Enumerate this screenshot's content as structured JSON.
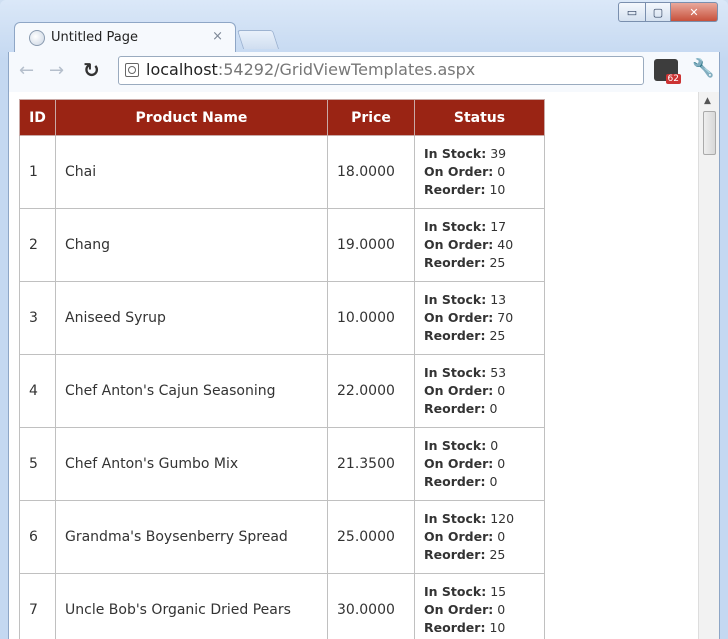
{
  "browser": {
    "tab_title": "Untitled Page",
    "tab_close": "×",
    "url_host": "localhost",
    "url_rest": ":54292/GridViewTemplates.aspx",
    "controls": {
      "minimize": "▭",
      "maximize": "▢",
      "close": "✕"
    }
  },
  "grid": {
    "headers": [
      "ID",
      "Product Name",
      "Price",
      "Status"
    ],
    "status_labels": {
      "in_stock": "In Stock:",
      "on_order": "On Order:",
      "reorder": "Reorder:"
    },
    "rows": [
      {
        "id": "1",
        "name": "Chai",
        "price": "18.0000",
        "in_stock": "39",
        "on_order": "0",
        "reorder": "10"
      },
      {
        "id": "2",
        "name": "Chang",
        "price": "19.0000",
        "in_stock": "17",
        "on_order": "40",
        "reorder": "25"
      },
      {
        "id": "3",
        "name": "Aniseed Syrup",
        "price": "10.0000",
        "in_stock": "13",
        "on_order": "70",
        "reorder": "25"
      },
      {
        "id": "4",
        "name": "Chef Anton's Cajun Seasoning",
        "price": "22.0000",
        "in_stock": "53",
        "on_order": "0",
        "reorder": "0"
      },
      {
        "id": "5",
        "name": "Chef Anton's Gumbo Mix",
        "price": "21.3500",
        "in_stock": "0",
        "on_order": "0",
        "reorder": "0"
      },
      {
        "id": "6",
        "name": "Grandma's Boysenberry Spread",
        "price": "25.0000",
        "in_stock": "120",
        "on_order": "0",
        "reorder": "25"
      },
      {
        "id": "7",
        "name": "Uncle Bob's Organic Dried Pears",
        "price": "30.0000",
        "in_stock": "15",
        "on_order": "0",
        "reorder": "10"
      }
    ]
  },
  "colors": {
    "header_bg": "#9a2414",
    "header_text": "#ffffff"
  }
}
